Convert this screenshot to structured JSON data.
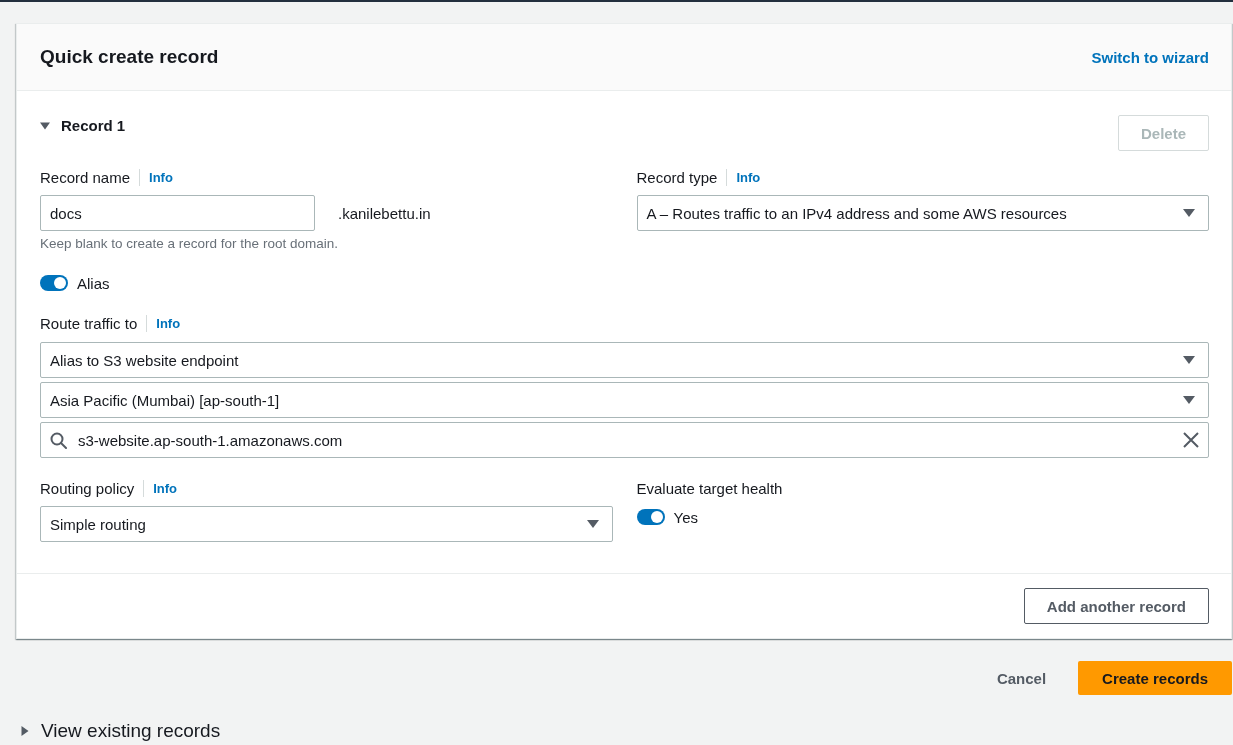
{
  "quick_create": {
    "title": "Quick create record",
    "switch_link": "Switch to wizard",
    "record": {
      "heading": "Record 1",
      "expanded": true,
      "delete_button": {
        "label": "Delete",
        "disabled": true
      },
      "record_name": {
        "label": "Record name",
        "info": "Info",
        "value": "docs",
        "suffix": ".kanilebettu.in",
        "hint": "Keep blank to create a record for the root domain."
      },
      "record_type": {
        "label": "Record type",
        "info": "Info",
        "value": "A – Routes traffic to an IPv4 address and some AWS resources"
      },
      "alias": {
        "label": "Alias",
        "on": true
      },
      "route_traffic_to": {
        "label": "Route traffic to",
        "info": "Info",
        "controls": [
          {
            "kind": "select",
            "value": "Alias to S3 website endpoint"
          },
          {
            "kind": "select",
            "value": "Asia Pacific (Mumbai) [ap-south-1]"
          },
          {
            "kind": "search",
            "value": "s3-website.ap-south-1.amazonaws.com"
          }
        ]
      },
      "routing_policy": {
        "label": "Routing policy",
        "info": "Info",
        "value": "Simple routing"
      },
      "evaluate_target_health": {
        "label": "Evaluate target health",
        "toggle_label": "Yes",
        "on": true
      }
    },
    "add_button": "Add another record"
  },
  "actions": [
    {
      "kind": "link",
      "label": "Cancel"
    },
    {
      "kind": "primary",
      "label": "Create records"
    }
  ],
  "existing_records": {
    "label": "View existing records",
    "expanded": false
  }
}
